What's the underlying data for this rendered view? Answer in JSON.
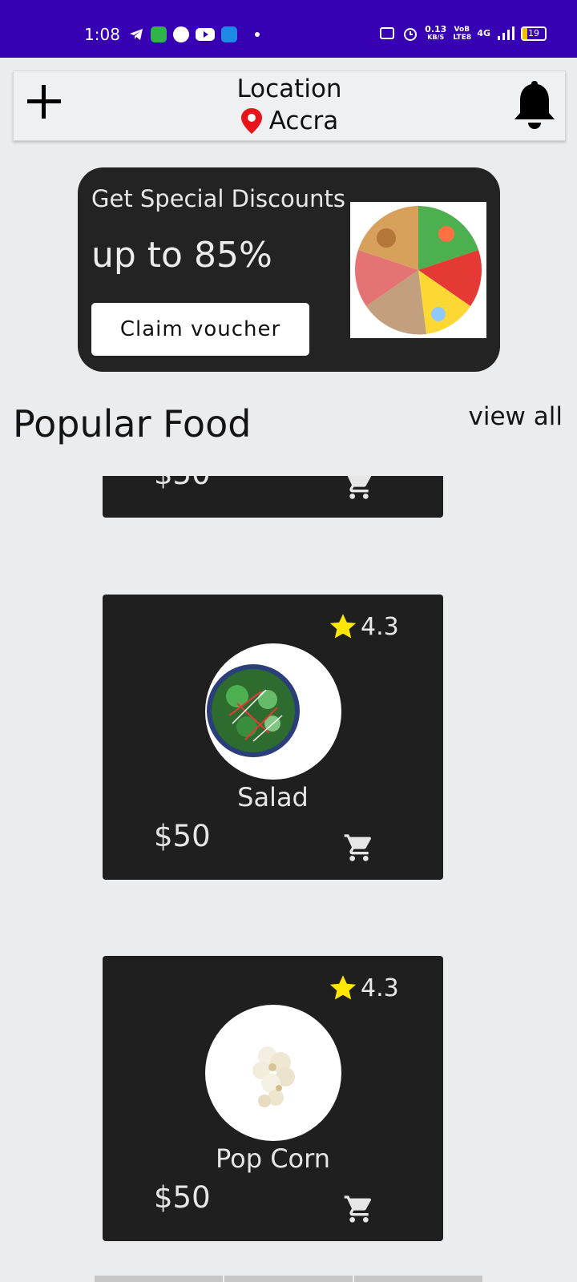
{
  "status_bar": {
    "time": "1:08",
    "net_speed": "0.13",
    "net_unit": "KB/S",
    "volte": "VoB LTE8",
    "signal": "4G",
    "battery": "19"
  },
  "app_bar": {
    "add_icon": "plus-icon",
    "location_label": "Location",
    "city": "Accra",
    "pin_icon": "location-pin-icon",
    "bell_icon": "bell-icon"
  },
  "promo": {
    "title": "Get Special Discounts",
    "headline": "up to 85%",
    "button_label": "Claim voucher",
    "colors": {
      "background": "#232323",
      "button": "#ffffff"
    }
  },
  "section": {
    "title": "Popular Food",
    "view_all": "view all"
  },
  "foods": [
    {
      "name": "",
      "price": "$50",
      "rating": ""
    },
    {
      "name": "Salad",
      "price": "$50",
      "rating": "4.3"
    },
    {
      "name": "Pop Corn",
      "price": "$50",
      "rating": "4.3"
    }
  ],
  "colors": {
    "status_bar": "#3700b3",
    "background": "#ebecee",
    "card": "#1f1f1f",
    "star": "#ffe600",
    "pin": "#e8141b"
  }
}
